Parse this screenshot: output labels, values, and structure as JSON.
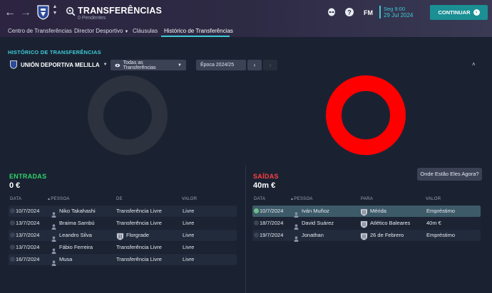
{
  "header": {
    "title": "TRANSFERÊNCIAS",
    "subtitle": "0 Pendentes",
    "fm_label": "FM",
    "date_time": "Seg 9:00",
    "date_day": "29 Jul 2024",
    "continue_label": "CONTINUAR",
    "icons": [
      "back-arrow-icon",
      "forward-arrow-icon",
      "club-crest-icon",
      "search-icon",
      "alien-icon",
      "help-icon"
    ]
  },
  "tabs": [
    {
      "label": "Centro de Transferências",
      "active": false
    },
    {
      "label": "Director Desportivo",
      "active": false,
      "dropdown": true
    },
    {
      "label": "Cláusulas",
      "active": false
    },
    {
      "label": "Histórico de Transferências",
      "active": true
    }
  ],
  "section": {
    "title": "HISTÓRICO DE TRANSFERÊNCIAS",
    "club_name": "UNIÓN DEPORTIVA MELILLA",
    "filter_label": "Todas as Transferências",
    "season_label": "Época 2024/25",
    "prev_symbol": "‹",
    "next_symbol": "›",
    "collapse_symbol": "˄"
  },
  "colors": {
    "accent": "#3ec9d6",
    "incoming": "#2fd46a",
    "outgoing": "#ff4040",
    "donut_out": "#ff0000",
    "donut_in": "#2c323e"
  },
  "incoming": {
    "heading": "ENTRADAS",
    "total": "0 €",
    "columns": {
      "date": "DATA",
      "person": "PESSOA",
      "from": "DE",
      "value": "VALOR"
    },
    "rows": [
      {
        "date": "10/7/2024",
        "person": "Niko Takahashi",
        "club": "Transferência Livre",
        "value": "Livre"
      },
      {
        "date": "13/7/2024",
        "person": "Braima Sambú",
        "club": "Transferência Livre",
        "value": "Livre"
      },
      {
        "date": "13/7/2024",
        "person": "Leandro Silva",
        "club": "Florgrade",
        "value": "Livre",
        "club_logo": true
      },
      {
        "date": "13/7/2024",
        "person": "Fábio Ferreira",
        "club": "Transferência Livre",
        "value": "Livre"
      },
      {
        "date": "16/7/2024",
        "person": "Musa",
        "club": "Transferência Livre",
        "value": "Livre"
      }
    ]
  },
  "outgoing": {
    "heading": "SAÍDAS",
    "total": "40m €",
    "where_button": "Onde Estão Eles Agora?",
    "columns": {
      "date": "DATA",
      "person": "PESSOA",
      "to": "PARA",
      "value": "VALOR"
    },
    "rows": [
      {
        "date": "10/7/2024",
        "person": "Iván Muñoz",
        "club": "Mérida",
        "value": "Empréstimo"
      },
      {
        "date": "18/7/2024",
        "person": "David Suárez",
        "club": "Atlético Baleares",
        "value": "40m €"
      },
      {
        "date": "19/7/2024",
        "person": "Jonathan",
        "club": "26 de Febrero",
        "value": "Empréstimo"
      }
    ]
  }
}
